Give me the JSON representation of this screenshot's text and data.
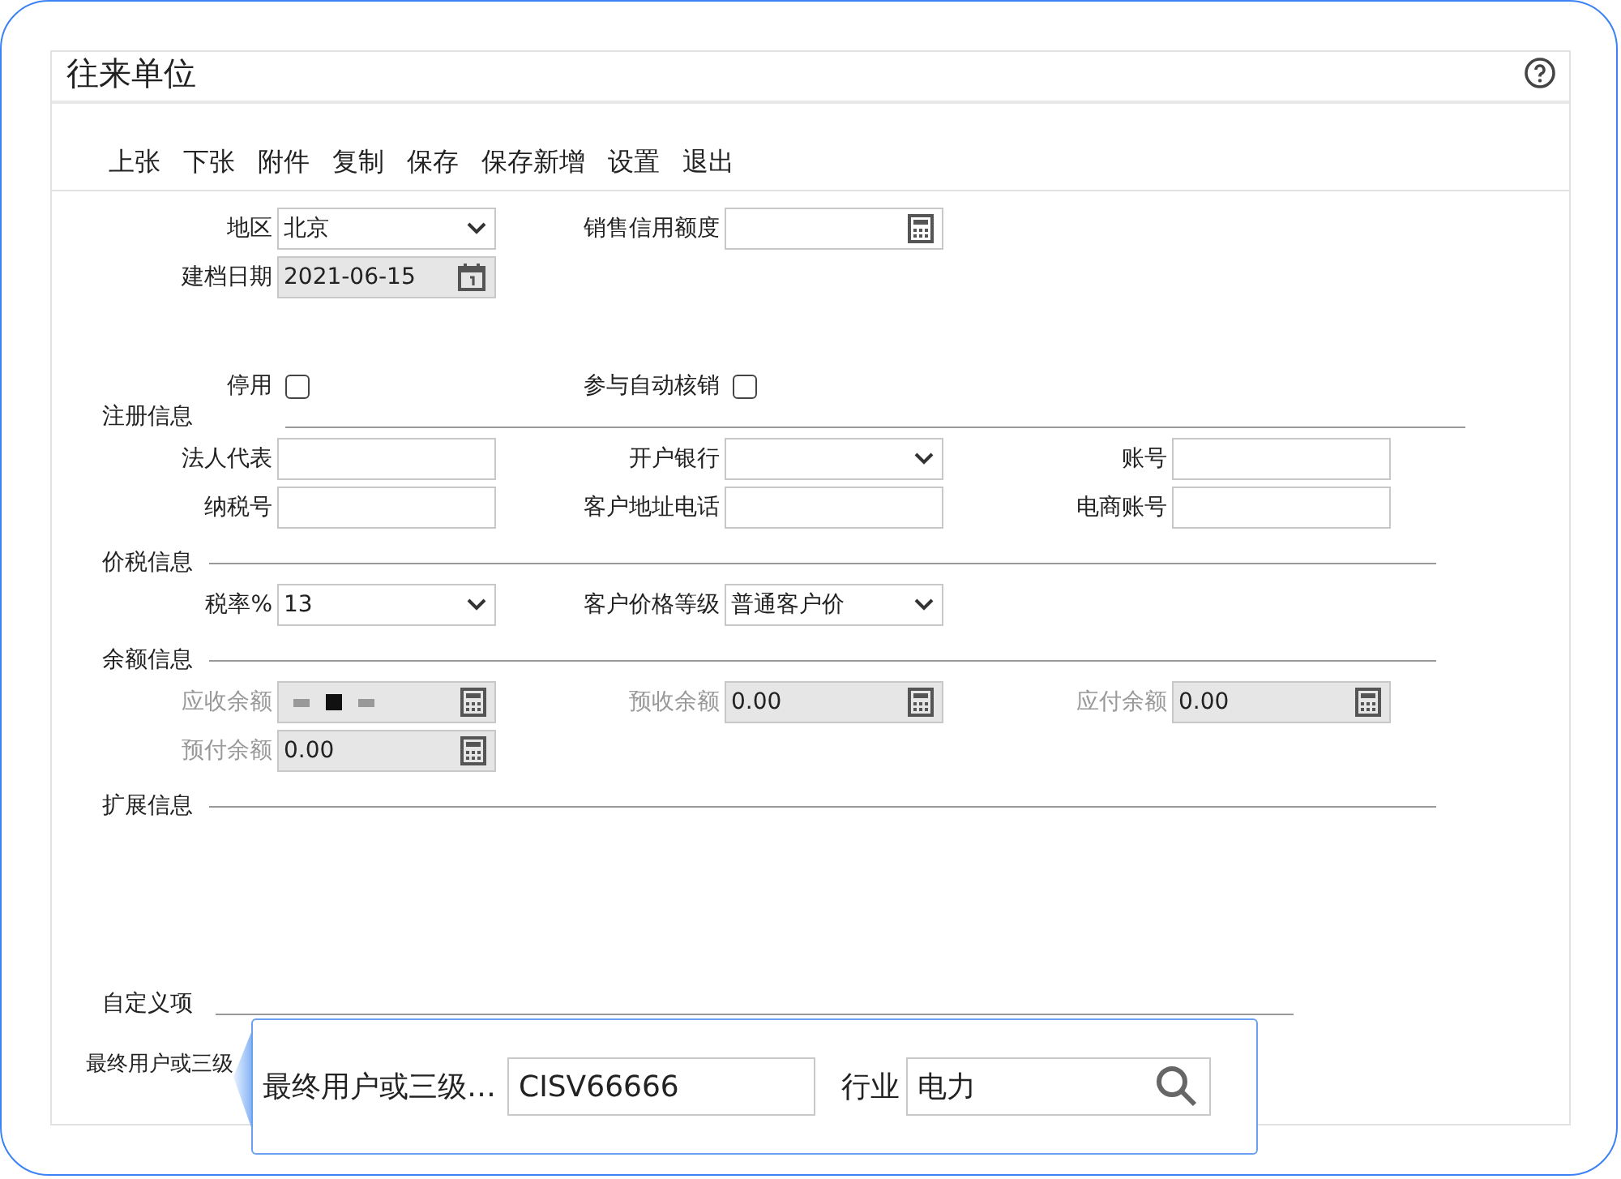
{
  "window": {
    "title": "往来单位"
  },
  "toolbar": [
    "上张",
    "下张",
    "附件",
    "复制",
    "保存",
    "保存新增",
    "设置",
    "退出"
  ],
  "sections": [
    {
      "rows": [
        [
          {
            "label": "地区",
            "kind": "select",
            "value": "北京"
          },
          {
            "label": "销售信用额度",
            "kind": "number"
          }
        ],
        [
          {
            "label": "建档日期",
            "kind": "date",
            "value": "2021-06-15",
            "readonly": true
          }
        ],
        [
          {
            "label": "停用",
            "kind": "checkbox",
            "checked": false
          },
          {
            "label": "参与自动核销",
            "kind": "checkbox",
            "checked": false
          }
        ]
      ]
    },
    {
      "title": "注册信息",
      "rows": [
        [
          {
            "label": "法人代表",
            "kind": "text"
          },
          {
            "label": "开户银行",
            "kind": "select"
          },
          {
            "label": "账号",
            "kind": "text"
          }
        ],
        [
          {
            "label": "纳税号",
            "kind": "text"
          },
          {
            "label": "客户地址电话",
            "kind": "text"
          },
          {
            "label": "电商账号",
            "kind": "text"
          }
        ]
      ]
    },
    {
      "title": "价税信息",
      "rows": [
        [
          {
            "label": "税率%",
            "kind": "select",
            "value": "13"
          },
          {
            "label": "客户价格等级",
            "kind": "select",
            "value": "普通客户价"
          }
        ]
      ]
    },
    {
      "title": "余额信息",
      "rows": [
        [
          {
            "label": "应收余额",
            "kind": "number",
            "disabled": true,
            "blurred": true
          },
          {
            "label": "预收余额",
            "kind": "number",
            "value": "0.00",
            "disabled": true
          },
          {
            "label": "应付余额",
            "kind": "number",
            "value": "0.00",
            "disabled": true
          }
        ],
        [
          {
            "label": "预付余额",
            "kind": "number",
            "value": "0.00",
            "disabled": true
          }
        ]
      ]
    },
    {
      "title": "扩展信息"
    },
    {
      "title": "自定义项"
    }
  ],
  "custom_label": "最终用户或三级",
  "popup": {
    "label": "最终用户或三级…",
    "value": "CISV66666",
    "industry_label": "行业",
    "industry_value": "电力"
  }
}
